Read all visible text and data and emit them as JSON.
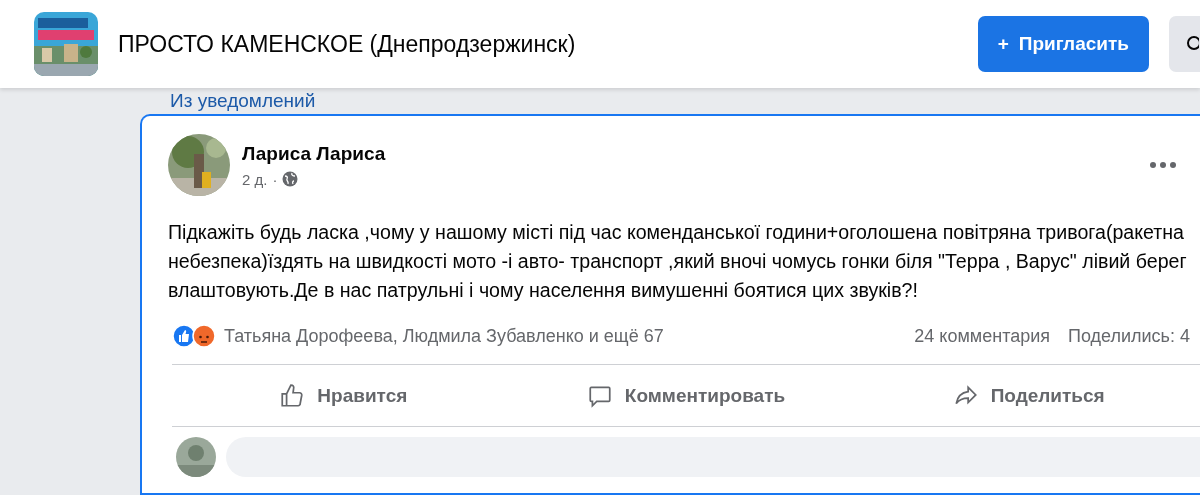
{
  "group": {
    "name": "ПРОСТО КАМЕНСКОЕ (Днепродзержинск)"
  },
  "header_buttons": [
    {
      "kind": "invite",
      "icon": "+",
      "label": "Пригласить"
    },
    {
      "kind": "search"
    }
  ],
  "notification_link": "Из уведомлений",
  "post": {
    "highlighted": true,
    "author": "Лариса Лариса",
    "time": "2 д.",
    "separator": "·",
    "text": "Підкажіть будь ласка ,чому у нашому місті під час коменданської години+оголошена повітряна тривога(ракетна небезпека)їздять на швидкості мото -і авто- транспорт ,який вночі чомусь гонки біля \"Терра , Варус\" лівий берег влаштовують.Де в нас патрульні і чому населення вимушенні боятися цих звуків?!",
    "reactions": {
      "kinds": [
        {
          "kind": "like"
        },
        {
          "kind": "angry"
        }
      ],
      "names": "Татьяна Дорофеева, Людмила Зубавленко и ещё 67"
    },
    "comments": "24 комментария",
    "shares": "Поделились: 4",
    "actions": [
      {
        "kind": "like",
        "label": "Нравится"
      },
      {
        "kind": "comment",
        "label": "Комментировать"
      },
      {
        "kind": "share",
        "label": "Поделиться"
      }
    ]
  }
}
